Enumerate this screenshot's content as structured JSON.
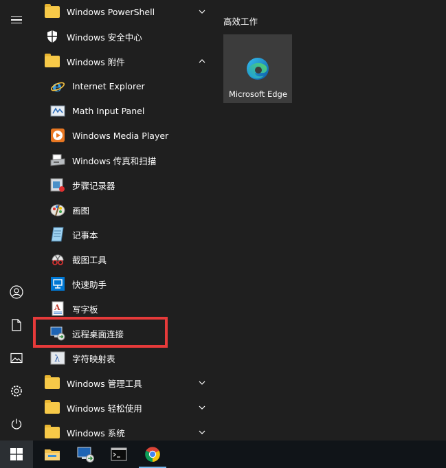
{
  "start_menu": {
    "apps": [
      {
        "label": "Windows PowerShell",
        "icon": "folder-icon",
        "expand": "chevron-down"
      },
      {
        "label": "Windows 安全中心",
        "icon": "shield-icon"
      },
      {
        "label": "Windows 附件",
        "icon": "folder-icon",
        "expand": "chevron-up"
      },
      {
        "label": "Internet Explorer",
        "icon": "internet-explorer-icon"
      },
      {
        "label": "Math Input Panel",
        "icon": "math-input-panel-icon"
      },
      {
        "label": "Windows Media Player",
        "icon": "media-player-icon"
      },
      {
        "label": "Windows 传真和扫描",
        "icon": "fax-scan-icon"
      },
      {
        "label": "步骤记录器",
        "icon": "steps-recorder-icon"
      },
      {
        "label": "画图",
        "icon": "paint-icon"
      },
      {
        "label": "记事本",
        "icon": "notepad-icon"
      },
      {
        "label": "截图工具",
        "icon": "snipping-tool-icon"
      },
      {
        "label": "快速助手",
        "icon": "quick-assist-icon"
      },
      {
        "label": "写字板",
        "icon": "wordpad-icon"
      },
      {
        "label": "远程桌面连接",
        "icon": "remote-desktop-icon"
      },
      {
        "label": "字符映射表",
        "icon": "character-map-icon"
      },
      {
        "label": "Windows 管理工具",
        "icon": "folder-icon",
        "expand": "chevron-down"
      },
      {
        "label": "Windows 轻松使用",
        "icon": "folder-icon",
        "expand": "chevron-down"
      },
      {
        "label": "Windows 系统",
        "icon": "folder-icon",
        "expand": "chevron-down"
      }
    ],
    "tiles": {
      "group_title": "高效工作",
      "items": [
        {
          "label": "Microsoft Edge",
          "icon": "edge-icon"
        }
      ]
    }
  },
  "colors": {
    "highlight": "#e63a3a",
    "folder": "#f7c948",
    "tile": "#3c3c3c",
    "taskbar": "#101418"
  }
}
